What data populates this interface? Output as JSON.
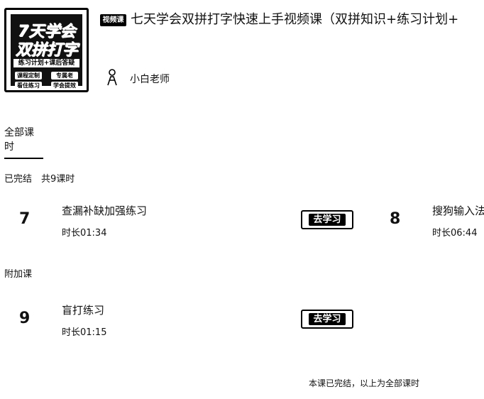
{
  "course": {
    "cover": {
      "line1": "7天学会",
      "line2": "双拼打字",
      "slogan": "练习计划+课后答疑",
      "tags": [
        "课程定制",
        "专属老",
        "看住练习",
        "学会提效"
      ]
    },
    "type_badge": "视频课",
    "title": "七天学会双拼打字快速上手视频课（双拼知识+练习计划+",
    "teacher": "小白老师"
  },
  "tabs": {
    "all": "全部课时"
  },
  "sections": {
    "completed": "已完结　共9课时",
    "extra": "附加课"
  },
  "lessons": [
    {
      "num": "7",
      "title": "查漏补缺加强练习",
      "duration": "时长01:34",
      "action": "去学习"
    },
    {
      "num": "8",
      "title": "搜狗输入法",
      "duration": "时长06:44"
    },
    {
      "num": "9",
      "title": "盲打练习",
      "duration": "时长01:15",
      "action": "去学习"
    }
  ],
  "footer": "本课已完结，以上为全部课时"
}
